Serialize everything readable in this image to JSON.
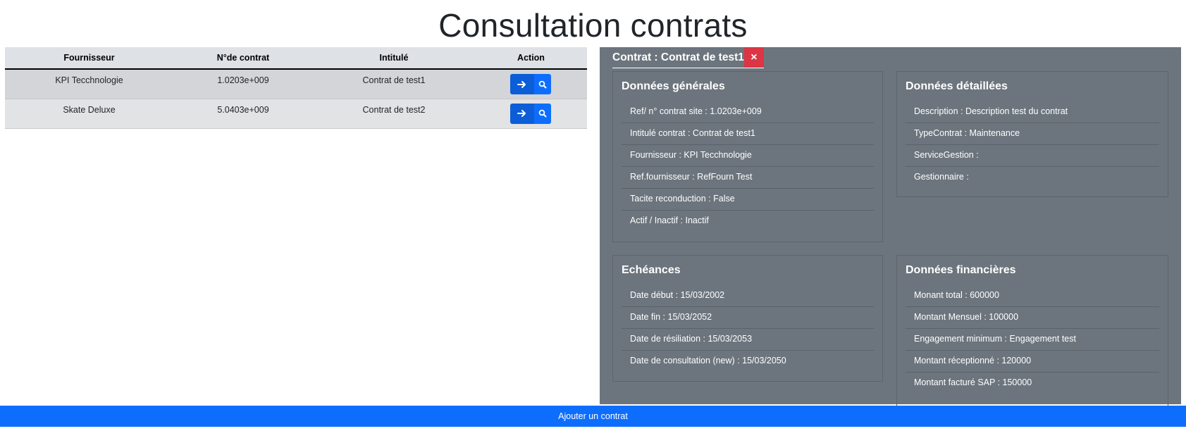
{
  "page": {
    "title": "Consultation contrats"
  },
  "table": {
    "headers": [
      "Fournisseur",
      "N°de contrat",
      "Intitulé",
      "Action"
    ],
    "rows": [
      {
        "fournisseur": "KPI Tecchnologie",
        "numero": "1.0203e+009",
        "intitule": "Contrat de test1"
      },
      {
        "fournisseur": "Skate Deluxe",
        "numero": "5.0403e+009",
        "intitule": "Contrat de test2"
      }
    ],
    "action_icons": {
      "go": "arrow-right-icon",
      "view": "search-icon"
    }
  },
  "detail": {
    "title": "Contrat : Contrat de test1",
    "close_label": "×",
    "generales": {
      "title": "Données générales",
      "items": [
        "Ref/ n° contrat site : 1.0203e+009",
        "Intitulé contrat : Contrat de test1",
        "Fournisseur : KPI Tecchnologie",
        "Ref.fournisseur : RefFourn Test",
        "Tacite reconduction : False",
        "Actif / Inactif : Inactif"
      ]
    },
    "detaillees": {
      "title": "Données détaillées",
      "items": [
        "Description : Description test du contrat",
        "TypeContrat : Maintenance",
        "ServiceGestion :",
        "Gestionnaire :"
      ]
    },
    "echeances": {
      "title": "Echéances",
      "items": [
        "Date début : 15/03/2002",
        "Date fin : 15/03/2052",
        "Date de résiliation : 15/03/2053",
        "Date de consultation (new) : 15/03/2050"
      ]
    },
    "financieres": {
      "title": "Données financières",
      "items": [
        "Monant total : 600000",
        "Montant Mensuel : 100000",
        "Engagement minimum : Engagement test",
        "Montant réceptionné : 120000",
        "Montant facturé SAP : 150000"
      ]
    }
  },
  "footer": {
    "add_label": "Ajouter un contrat"
  },
  "colors": {
    "primary": "#0d6efd",
    "danger": "#dc3545",
    "panel": "#6c757d"
  }
}
